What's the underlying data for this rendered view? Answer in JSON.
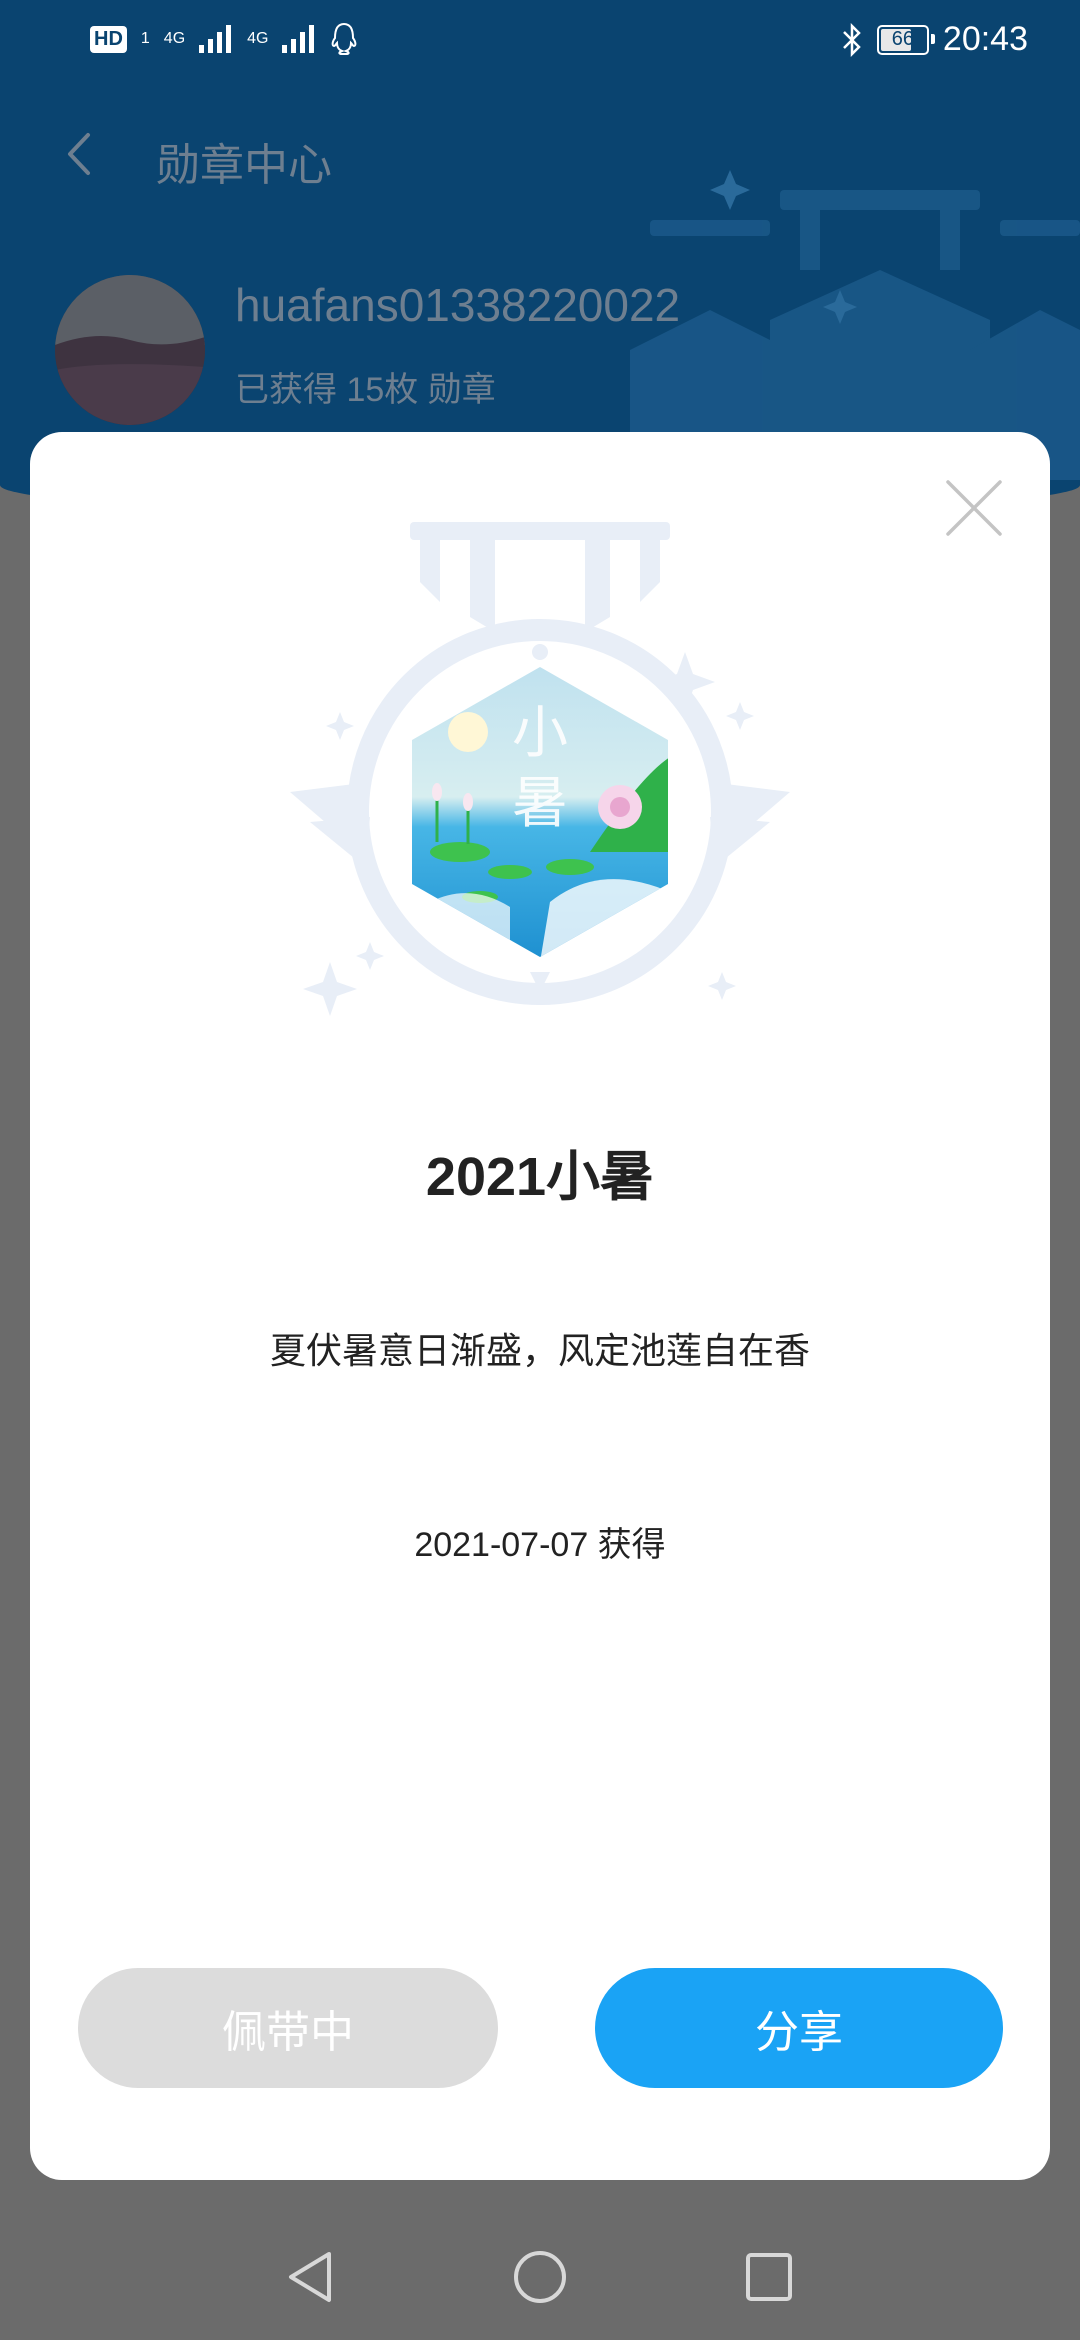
{
  "status_bar": {
    "hd": "HD",
    "sim": "1",
    "net1": "4G",
    "net2": "4G",
    "battery": "66",
    "time": "20:43"
  },
  "header": {
    "title": "勋章中心",
    "username": "huafans01338220022",
    "badge_count_text": "已获得 15枚 勋章"
  },
  "modal": {
    "medal_text": "小暑",
    "badge_title": "2021小暑",
    "description": "夏伏暑意日渐盛，风定池莲自在香",
    "date_text": "2021-07-07 获得",
    "wearing_label": "佩带中",
    "share_label": "分享"
  },
  "colors": {
    "header_bg": "#0a4470",
    "dim_bg": "#6b6b6b",
    "share_button": "#1aa3f5",
    "wearing_button": "#dcdcdc"
  }
}
